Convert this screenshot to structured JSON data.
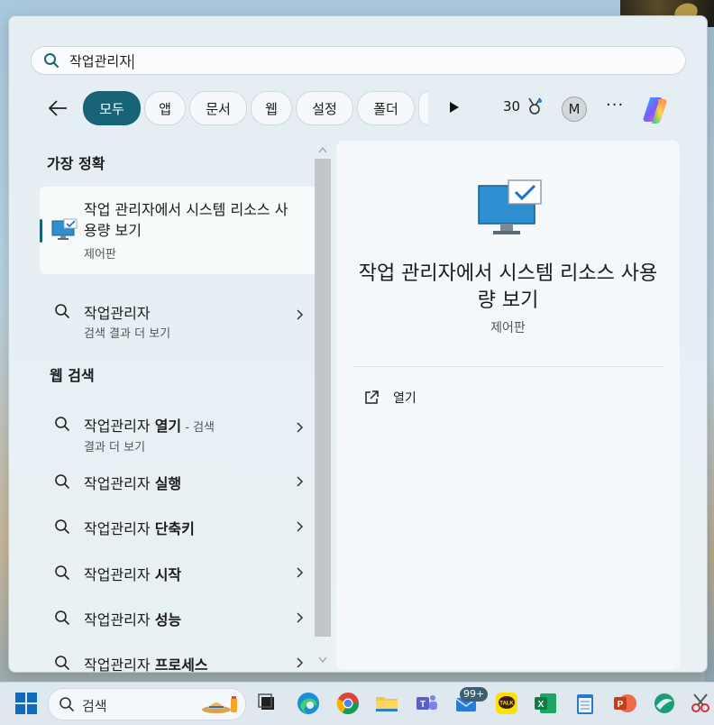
{
  "search": {
    "query": "작업관리자"
  },
  "filters": {
    "chips": [
      {
        "label": "모두",
        "active": true
      },
      {
        "label": "앱",
        "active": false
      },
      {
        "label": "문서",
        "active": false
      },
      {
        "label": "웹",
        "active": false
      },
      {
        "label": "설정",
        "active": false
      },
      {
        "label": "폴더",
        "active": false
      }
    ],
    "points": "30",
    "avatar_initial": "M",
    "more_label": "···"
  },
  "results": {
    "best_match_heading": "가장 정확",
    "best_match": {
      "title": "작업 관리자에서 시스템 리소스 사용량 보기",
      "category": "제어판"
    },
    "search_item": {
      "label": "작업관리자",
      "sub": "검색 결과 더 보기"
    },
    "web_heading": "웹 검색",
    "web_items": [
      {
        "prefix": "작업관리자 ",
        "bold": "열기",
        "hint": " - 검색",
        "sub": "결과 더 보기"
      },
      {
        "prefix": "작업관리자 ",
        "bold": "실행"
      },
      {
        "prefix": "작업관리자 ",
        "bold": "단축키"
      },
      {
        "prefix": "작업관리자 ",
        "bold": "시작"
      },
      {
        "prefix": "작업관리자 ",
        "bold": "성능"
      },
      {
        "prefix": "작업관리자 ",
        "bold": "프로세스"
      }
    ]
  },
  "detail": {
    "title": "작업 관리자에서 시스템 리소스 사용량 보기",
    "category": "제어판",
    "actions": [
      {
        "label": "열기",
        "icon": "open-external-icon"
      }
    ]
  },
  "taskbar": {
    "search_placeholder": "검색",
    "mail_badge": "99+",
    "apps": [
      "start-icon",
      "task-view-icon",
      "edge-icon",
      "chrome-icon",
      "file-explorer-icon",
      "teams-icon",
      "mail-icon",
      "kakaotalk-icon",
      "excel-icon",
      "notepad-icon",
      "powerpoint-icon",
      "copilot-icon",
      "snipping-tool-icon"
    ]
  },
  "colors": {
    "accent": "#196376",
    "panel": "#e9f1f4",
    "taskbar": "#dfe8ef"
  }
}
